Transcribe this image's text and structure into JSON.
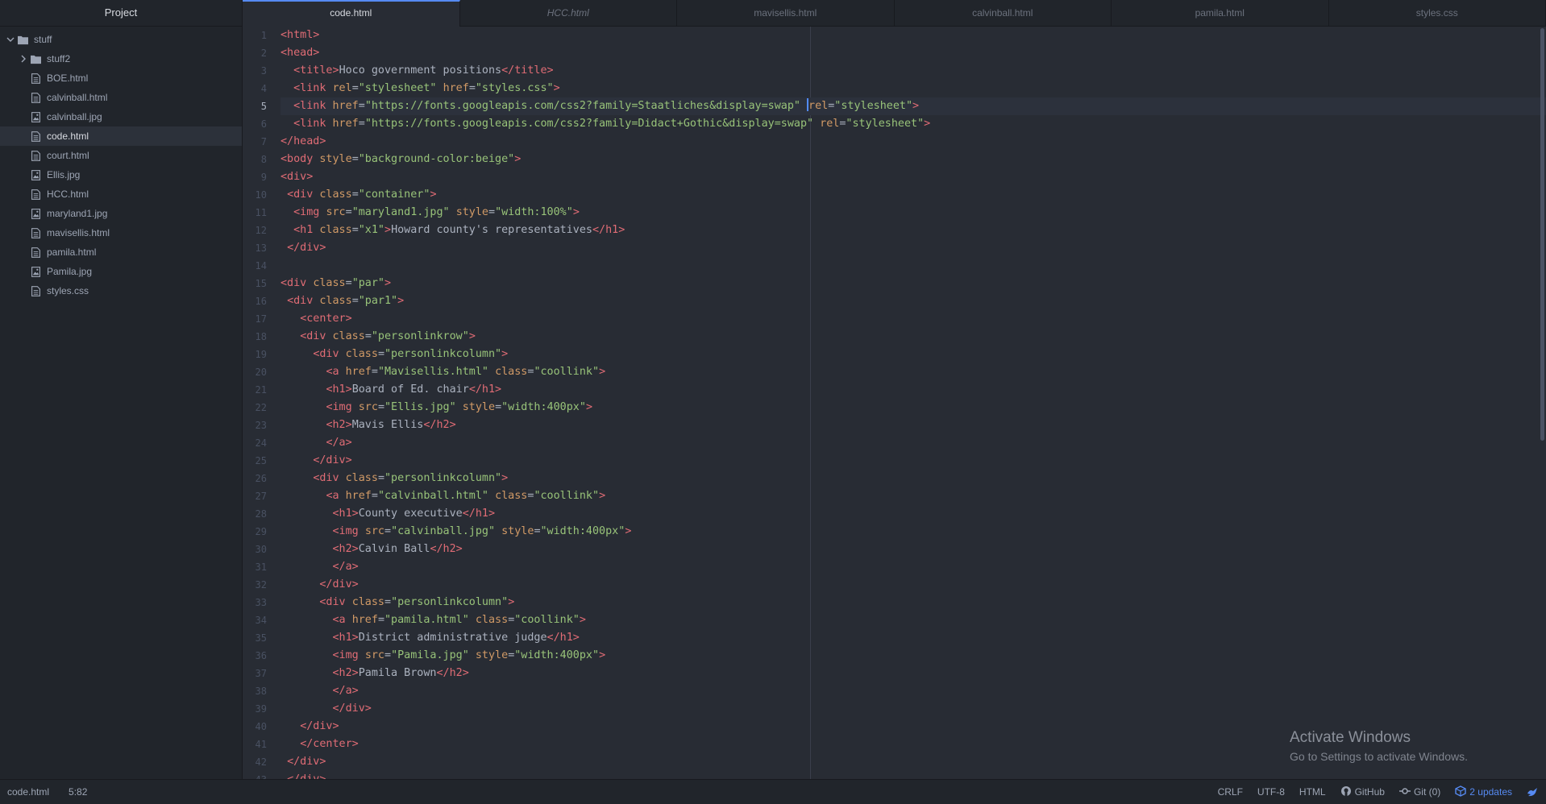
{
  "sidebar": {
    "title": "Project",
    "root": "stuff",
    "items": [
      {
        "label": "stuff2",
        "kind": "folder",
        "icon": "folder-icon"
      },
      {
        "label": "BOE.html",
        "kind": "file",
        "icon": "file-icon"
      },
      {
        "label": "calvinball.html",
        "kind": "file",
        "icon": "file-icon"
      },
      {
        "label": "calvinball.jpg",
        "kind": "image",
        "icon": "image-file-icon"
      },
      {
        "label": "code.html",
        "kind": "file",
        "icon": "file-icon",
        "selected": true
      },
      {
        "label": "court.html",
        "kind": "file",
        "icon": "file-icon"
      },
      {
        "label": "Ellis.jpg",
        "kind": "image",
        "icon": "image-file-icon"
      },
      {
        "label": "HCC.html",
        "kind": "file",
        "icon": "file-icon"
      },
      {
        "label": "maryland1.jpg",
        "kind": "image",
        "icon": "image-file-icon"
      },
      {
        "label": "mavisellis.html",
        "kind": "file",
        "icon": "file-icon"
      },
      {
        "label": "pamila.html",
        "kind": "file",
        "icon": "file-icon"
      },
      {
        "label": "Pamila.jpg",
        "kind": "image",
        "icon": "image-file-icon"
      },
      {
        "label": "styles.css",
        "kind": "file",
        "icon": "file-icon"
      }
    ]
  },
  "tabs": [
    {
      "label": "code.html",
      "active": true
    },
    {
      "label": "HCC.html",
      "italic": true
    },
    {
      "label": "mavisellis.html"
    },
    {
      "label": "calvinball.html"
    },
    {
      "label": "pamila.html"
    },
    {
      "label": "styles.css"
    }
  ],
  "editor": {
    "current_line": 5,
    "lines": [
      [
        [
          "t",
          "<html>"
        ]
      ],
      [
        [
          "t",
          "<head>"
        ]
      ],
      [
        [
          "s",
          "  "
        ],
        [
          "t",
          "<title>"
        ],
        [
          "x",
          "Hoco government positions"
        ],
        [
          "t",
          "</title>"
        ]
      ],
      [
        [
          "s",
          "  "
        ],
        [
          "t",
          "<link "
        ],
        [
          "a",
          "rel"
        ],
        [
          "x",
          "="
        ],
        [
          "g",
          "\"stylesheet\""
        ],
        [
          "x",
          " "
        ],
        [
          "a",
          "href"
        ],
        [
          "x",
          "="
        ],
        [
          "g",
          "\"styles.css\""
        ],
        [
          "t",
          ">"
        ]
      ],
      [
        [
          "s",
          "  "
        ],
        [
          "t",
          "<link "
        ],
        [
          "a",
          "href"
        ],
        [
          "x",
          "="
        ],
        [
          "g",
          "\"https://fonts.googleapis.com/css2?family=Staatliches&display=swap\""
        ],
        [
          "x",
          " "
        ],
        [
          "c",
          ""
        ],
        [
          "a",
          "rel"
        ],
        [
          "x",
          "="
        ],
        [
          "g",
          "\"stylesheet\""
        ],
        [
          "t",
          ">"
        ]
      ],
      [
        [
          "s",
          "  "
        ],
        [
          "t",
          "<link "
        ],
        [
          "a",
          "href"
        ],
        [
          "x",
          "="
        ],
        [
          "g",
          "\"https://fonts.googleapis.com/css2?family=Didact+Gothic&display=swap\""
        ],
        [
          "x",
          " "
        ],
        [
          "a",
          "rel"
        ],
        [
          "x",
          "="
        ],
        [
          "g",
          "\"stylesheet\""
        ],
        [
          "t",
          ">"
        ]
      ],
      [
        [
          "t",
          "</head>"
        ]
      ],
      [
        [
          "t",
          "<body "
        ],
        [
          "a",
          "style"
        ],
        [
          "x",
          "="
        ],
        [
          "g",
          "\"background-color:beige\""
        ],
        [
          "t",
          ">"
        ]
      ],
      [
        [
          "t",
          "<div>"
        ]
      ],
      [
        [
          "s",
          " "
        ],
        [
          "t",
          "<div "
        ],
        [
          "a",
          "class"
        ],
        [
          "x",
          "="
        ],
        [
          "g",
          "\"container\""
        ],
        [
          "t",
          ">"
        ]
      ],
      [
        [
          "s",
          "  "
        ],
        [
          "t",
          "<img "
        ],
        [
          "a",
          "src"
        ],
        [
          "x",
          "="
        ],
        [
          "g",
          "\"maryland1.jpg\""
        ],
        [
          "x",
          " "
        ],
        [
          "a",
          "style"
        ],
        [
          "x",
          "="
        ],
        [
          "g",
          "\"width:100%\""
        ],
        [
          "t",
          ">"
        ]
      ],
      [
        [
          "s",
          "  "
        ],
        [
          "t",
          "<h1 "
        ],
        [
          "a",
          "class"
        ],
        [
          "x",
          "="
        ],
        [
          "g",
          "\"x1\""
        ],
        [
          "t",
          ">"
        ],
        [
          "x",
          "Howard county's representatives"
        ],
        [
          "t",
          "</h1>"
        ]
      ],
      [
        [
          "s",
          " "
        ],
        [
          "t",
          "</div>"
        ]
      ],
      [],
      [
        [
          "t",
          "<div "
        ],
        [
          "a",
          "class"
        ],
        [
          "x",
          "="
        ],
        [
          "g",
          "\"par\""
        ],
        [
          "t",
          ">"
        ]
      ],
      [
        [
          "s",
          " "
        ],
        [
          "t",
          "<div "
        ],
        [
          "a",
          "class"
        ],
        [
          "x",
          "="
        ],
        [
          "g",
          "\"par1\""
        ],
        [
          "t",
          ">"
        ]
      ],
      [
        [
          "s",
          "   "
        ],
        [
          "t",
          "<center>"
        ]
      ],
      [
        [
          "s",
          "   "
        ],
        [
          "t",
          "<div "
        ],
        [
          "a",
          "class"
        ],
        [
          "x",
          "="
        ],
        [
          "g",
          "\"personlinkrow\""
        ],
        [
          "t",
          ">"
        ]
      ],
      [
        [
          "s",
          "     "
        ],
        [
          "t",
          "<div "
        ],
        [
          "a",
          "class"
        ],
        [
          "x",
          "="
        ],
        [
          "g",
          "\"personlinkcolumn\""
        ],
        [
          "t",
          ">"
        ]
      ],
      [
        [
          "s",
          "       "
        ],
        [
          "t",
          "<a "
        ],
        [
          "a",
          "href"
        ],
        [
          "x",
          "="
        ],
        [
          "g",
          "\"Mavisellis.html\""
        ],
        [
          "x",
          " "
        ],
        [
          "a",
          "class"
        ],
        [
          "x",
          "="
        ],
        [
          "g",
          "\"coollink\""
        ],
        [
          "t",
          ">"
        ]
      ],
      [
        [
          "s",
          "       "
        ],
        [
          "t",
          "<h1>"
        ],
        [
          "x",
          "Board of Ed. chair"
        ],
        [
          "t",
          "</h1>"
        ]
      ],
      [
        [
          "s",
          "       "
        ],
        [
          "t",
          "<img "
        ],
        [
          "a",
          "src"
        ],
        [
          "x",
          "="
        ],
        [
          "g",
          "\"Ellis.jpg\""
        ],
        [
          "x",
          " "
        ],
        [
          "a",
          "style"
        ],
        [
          "x",
          "="
        ],
        [
          "g",
          "\"width:400px\""
        ],
        [
          "t",
          ">"
        ]
      ],
      [
        [
          "s",
          "       "
        ],
        [
          "t",
          "<h2>"
        ],
        [
          "x",
          "Mavis Ellis"
        ],
        [
          "t",
          "</h2>"
        ]
      ],
      [
        [
          "s",
          "       "
        ],
        [
          "t",
          "</a>"
        ]
      ],
      [
        [
          "s",
          "     "
        ],
        [
          "t",
          "</div>"
        ]
      ],
      [
        [
          "s",
          "     "
        ],
        [
          "t",
          "<div "
        ],
        [
          "a",
          "class"
        ],
        [
          "x",
          "="
        ],
        [
          "g",
          "\"personlinkcolumn\""
        ],
        [
          "t",
          ">"
        ]
      ],
      [
        [
          "s",
          "       "
        ],
        [
          "t",
          "<a "
        ],
        [
          "a",
          "href"
        ],
        [
          "x",
          "="
        ],
        [
          "g",
          "\"calvinball.html\""
        ],
        [
          "x",
          " "
        ],
        [
          "a",
          "class"
        ],
        [
          "x",
          "="
        ],
        [
          "g",
          "\"coollink\""
        ],
        [
          "t",
          ">"
        ]
      ],
      [
        [
          "s",
          "        "
        ],
        [
          "t",
          "<h1>"
        ],
        [
          "x",
          "County executive"
        ],
        [
          "t",
          "</h1>"
        ]
      ],
      [
        [
          "s",
          "        "
        ],
        [
          "t",
          "<img "
        ],
        [
          "a",
          "src"
        ],
        [
          "x",
          "="
        ],
        [
          "g",
          "\"calvinball.jpg\""
        ],
        [
          "x",
          " "
        ],
        [
          "a",
          "style"
        ],
        [
          "x",
          "="
        ],
        [
          "g",
          "\"width:400px\""
        ],
        [
          "t",
          ">"
        ]
      ],
      [
        [
          "s",
          "        "
        ],
        [
          "t",
          "<h2>"
        ],
        [
          "x",
          "Calvin Ball"
        ],
        [
          "t",
          "</h2>"
        ]
      ],
      [
        [
          "s",
          "        "
        ],
        [
          "t",
          "</a>"
        ]
      ],
      [
        [
          "s",
          "      "
        ],
        [
          "t",
          "</div>"
        ]
      ],
      [
        [
          "s",
          "      "
        ],
        [
          "t",
          "<div "
        ],
        [
          "a",
          "class"
        ],
        [
          "x",
          "="
        ],
        [
          "g",
          "\"personlinkcolumn\""
        ],
        [
          "t",
          ">"
        ]
      ],
      [
        [
          "s",
          "        "
        ],
        [
          "t",
          "<a "
        ],
        [
          "a",
          "href"
        ],
        [
          "x",
          "="
        ],
        [
          "g",
          "\"pamila.html\""
        ],
        [
          "x",
          " "
        ],
        [
          "a",
          "class"
        ],
        [
          "x",
          "="
        ],
        [
          "g",
          "\"coollink\""
        ],
        [
          "t",
          ">"
        ]
      ],
      [
        [
          "s",
          "        "
        ],
        [
          "t",
          "<h1>"
        ],
        [
          "x",
          "District administrative judge"
        ],
        [
          "t",
          "</h1>"
        ]
      ],
      [
        [
          "s",
          "        "
        ],
        [
          "t",
          "<img "
        ],
        [
          "a",
          "src"
        ],
        [
          "x",
          "="
        ],
        [
          "g",
          "\"Pamila.jpg\""
        ],
        [
          "x",
          " "
        ],
        [
          "a",
          "style"
        ],
        [
          "x",
          "="
        ],
        [
          "g",
          "\"width:400px\""
        ],
        [
          "t",
          ">"
        ]
      ],
      [
        [
          "s",
          "        "
        ],
        [
          "t",
          "<h2>"
        ],
        [
          "x",
          "Pamila Brown"
        ],
        [
          "t",
          "</h2>"
        ]
      ],
      [
        [
          "s",
          "        "
        ],
        [
          "t",
          "</a>"
        ]
      ],
      [
        [
          "s",
          "        "
        ],
        [
          "t",
          "</div>"
        ]
      ],
      [
        [
          "s",
          "   "
        ],
        [
          "t",
          "</div>"
        ]
      ],
      [
        [
          "s",
          "   "
        ],
        [
          "t",
          "</center>"
        ]
      ],
      [
        [
          "s",
          " "
        ],
        [
          "t",
          "</div>"
        ]
      ],
      [
        [
          "s",
          " "
        ],
        [
          "t",
          "</div>"
        ]
      ]
    ]
  },
  "watermark": {
    "title": "Activate Windows",
    "subtitle": "Go to Settings to activate Windows."
  },
  "statusbar": {
    "file": "code.html",
    "cursor": "5:82",
    "line_ending": "CRLF",
    "encoding": "UTF-8",
    "grammar": "HTML",
    "github": "GitHub",
    "git": "Git (0)",
    "updates": "2 updates"
  },
  "colors": {
    "accent": "#568af2",
    "tag": "#e06c75",
    "attr": "#d19a66",
    "string": "#98c379"
  }
}
